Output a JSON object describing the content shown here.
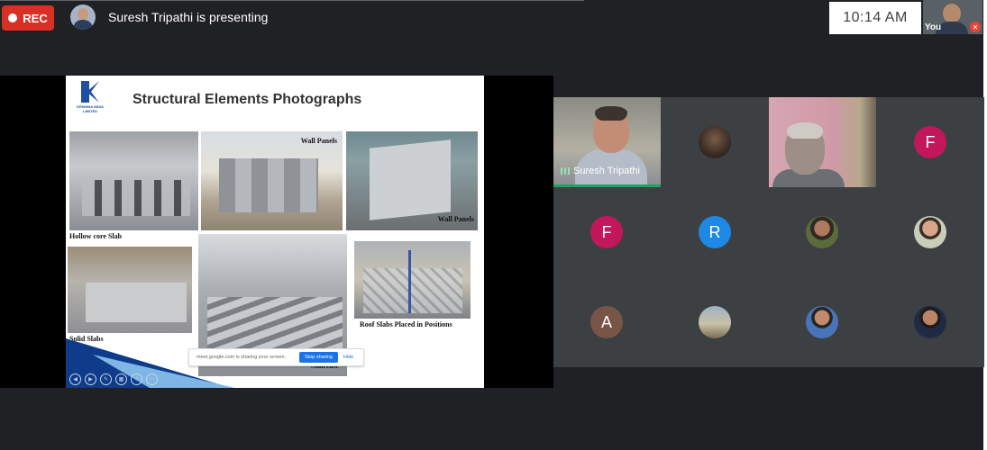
{
  "topbar": {
    "rec_label": "REC",
    "presenter_text": "Suresh Tripathi is presenting",
    "clock": "10:14  AM",
    "self_label": "You"
  },
  "slide": {
    "logo_text": "KRISHNA INDIA LIMITED",
    "title": "Structural Elements Photographs",
    "captions": {
      "hollow_core": "Hollow core Slab",
      "wall_panels_1": "Wall Panels",
      "wall_panels_2": "Wall Panels",
      "solid_slabs": "Solid Slabs",
      "staircase": "Staircase",
      "roof_slabs": "Roof   Slabs   Placed   in Positions"
    },
    "share_bar": {
      "message": "meet.google.com is sharing your screen.",
      "stop_label": "Stop sharing",
      "hide_label": "Hide"
    }
  },
  "participants": [
    {
      "name": "Suresh Tripathi",
      "type": "video",
      "speaking": true
    },
    {
      "initial": "",
      "type": "photo",
      "photo": "dark-photo"
    },
    {
      "name": "",
      "type": "video"
    },
    {
      "initial": "F",
      "type": "letter",
      "color": "#c2185b"
    },
    {
      "initial": "F",
      "type": "letter",
      "color": "#c2185b"
    },
    {
      "initial": "R",
      "type": "letter",
      "color": "#1e88e5"
    },
    {
      "initial": "",
      "type": "photo",
      "photo": "man-green"
    },
    {
      "initial": "",
      "type": "photo",
      "photo": "man-light"
    },
    {
      "initial": "A",
      "type": "letter",
      "color": "#795548"
    },
    {
      "initial": "",
      "type": "photo",
      "photo": "outdoor"
    },
    {
      "initial": "",
      "type": "photo",
      "photo": "man-blue"
    },
    {
      "initial": "",
      "type": "photo",
      "photo": "man-suit"
    }
  ],
  "colors": {
    "rec": "#d93025",
    "background": "#202124",
    "tile": "#3c4043",
    "accent_blue": "#1a73e8",
    "speaking_green": "#1ea362"
  },
  "icons": [
    "record-dot-icon",
    "mic-off-icon",
    "audio-bars-icon"
  ]
}
